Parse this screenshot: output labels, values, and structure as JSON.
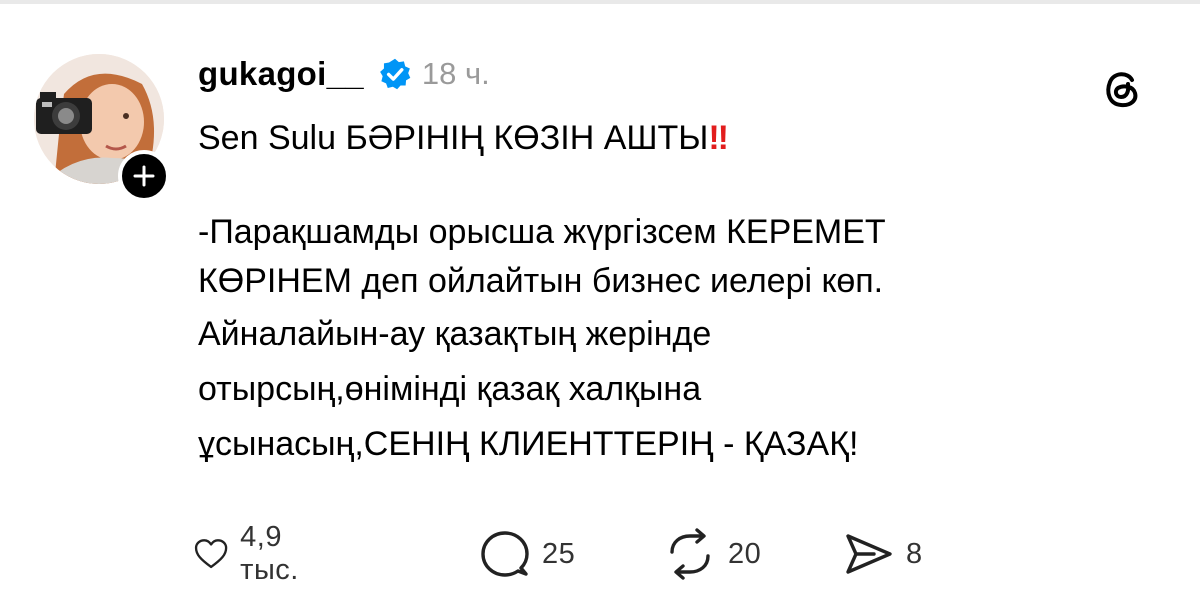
{
  "post": {
    "username": "gukagoi__",
    "time": "18 ч.",
    "line1_main": "Sen Sulu БӘРІНІҢ КӨЗІН АШТЫ",
    "line1_emoji": "‼",
    "para_lines": [
      "-Парақшамды орысша жүргізсем КЕРЕМЕТ",
      "КӨРІНЕМ деп ойлайтын бизнес иелері көп.",
      "Айналайын-ау қазақтың жерінде",
      "отырсың,өнімінді қазақ халқына",
      "ұсынасың,СЕНІҢ КЛИЕНТТЕРІҢ - ҚАЗАҚ!"
    ]
  },
  "actions": {
    "likes": "4,9 тыс.",
    "comments": "25",
    "reposts": "20",
    "shares": "8"
  },
  "icons": [
    "avatar",
    "follow-plus-icon",
    "verified-badge-icon",
    "threads-logo-icon",
    "heart-icon",
    "comment-icon",
    "repost-icon",
    "share-icon"
  ],
  "colors": {
    "verified": "#0095f6",
    "emoji": "#e21d1d",
    "time": "#9a9a9a"
  }
}
